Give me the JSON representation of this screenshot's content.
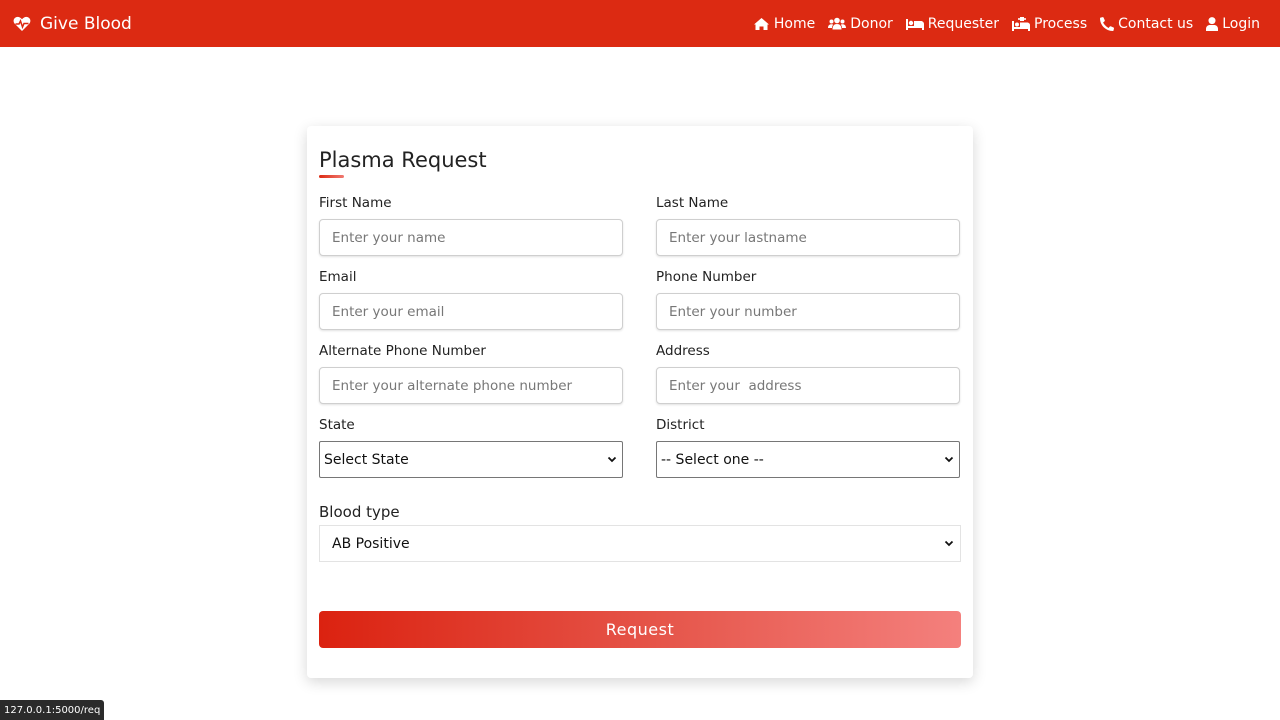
{
  "brand": {
    "name": "Give Blood",
    "icon": "heartbeat-icon"
  },
  "nav": [
    {
      "label": "Home",
      "icon": "home-icon"
    },
    {
      "label": "Donor",
      "icon": "users-icon"
    },
    {
      "label": "Requester",
      "icon": "bed-icon"
    },
    {
      "label": "Process",
      "icon": "procedures-icon"
    },
    {
      "label": "Contact us",
      "icon": "phone-icon"
    },
    {
      "label": "Login",
      "icon": "user-icon"
    }
  ],
  "form": {
    "title": "Plasma Request",
    "first_name": {
      "label": "First Name",
      "placeholder": "Enter your name",
      "value": ""
    },
    "last_name": {
      "label": "Last Name",
      "placeholder": "Enter your lastname",
      "value": ""
    },
    "email": {
      "label": "Email",
      "placeholder": "Enter your email",
      "value": ""
    },
    "phone": {
      "label": "Phone Number",
      "placeholder": "Enter your number",
      "value": ""
    },
    "alt_phone": {
      "label": "Alternate Phone Number",
      "placeholder": "Enter your alternate phone number",
      "value": ""
    },
    "address": {
      "label": "Address",
      "placeholder": "Enter your  address",
      "value": ""
    },
    "state": {
      "label": "State",
      "selected": "Select State"
    },
    "district": {
      "label": "District",
      "selected": "-- Select one --"
    },
    "blood_type": {
      "label": "Blood type",
      "selected": "AB Positive"
    },
    "submit_label": "Request"
  },
  "status_url": "127.0.0.1:5000/req",
  "colors": {
    "primary": "#dc2a12",
    "gradient_end": "#f4807d"
  }
}
